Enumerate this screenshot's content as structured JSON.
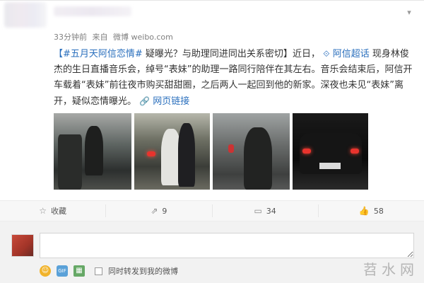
{
  "post": {
    "meta": {
      "time": "33分钟前",
      "source_prefix": "来自",
      "source": "微博 weibo.com"
    },
    "text": {
      "hashtag": "【#五月天阿信恋情#",
      "headline": " 疑曝光？与助理同进同出关系密切】",
      "body1": "近日，",
      "super_topic_icon": "⟐",
      "super_topic": "阿信超话",
      "body2": " 现身林俊杰的生日直播音乐会，绰号“表妹”的助理一路同行陪伴在其左右。音乐会结束后，阿信开车载着“表妹”前往夜市购买甜甜圈，之后两人一起回到他的新家。深夜也未见“表妹”离开，疑似恋情曝光。",
      "web_link_icon": "🔗",
      "web_link": "网页链接"
    }
  },
  "actions": {
    "favorite": {
      "icon": "☆",
      "label": "收藏"
    },
    "repost": {
      "icon": "⇗",
      "count": "9"
    },
    "comment": {
      "icon": "▭",
      "count": "34"
    },
    "like": {
      "icon": "👍",
      "count": "58"
    }
  },
  "comment_box": {
    "value": "",
    "tools": {
      "emoji": "☺",
      "gif": "GIF",
      "picture": "▦"
    },
    "repost_label": "同时转发到我的微博"
  },
  "watermark": "苕水网",
  "colors": {
    "link": "#2a6fbd",
    "text": "#333333",
    "meta": "#808080"
  }
}
